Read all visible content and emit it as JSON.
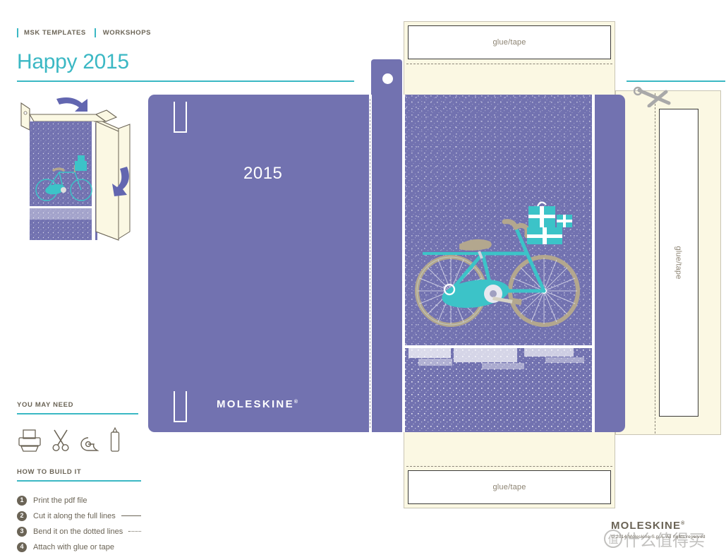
{
  "breadcrumb": {
    "items": [
      {
        "label": "MSK TEMPLATES"
      },
      {
        "label": "WORKSHOPS"
      }
    ]
  },
  "header": {
    "title": "Happy 2015"
  },
  "cover": {
    "year": "2015",
    "brand": "MOLESKINE",
    "brand_mark": "®"
  },
  "dieline": {
    "glue_top_label": "glue/tape",
    "glue_bottom_label": "glue/tape",
    "glue_right_label": "glue/tape"
  },
  "need": {
    "heading": "YOU MAY NEED",
    "tools": [
      {
        "name": "printer-icon",
        "label": "printer"
      },
      {
        "name": "scissors-icon",
        "label": "scissors"
      },
      {
        "name": "tape-icon",
        "label": "tape"
      },
      {
        "name": "glue-bottle-icon",
        "label": "glue"
      }
    ]
  },
  "build": {
    "heading": "HOW TO BUILD IT",
    "steps": [
      {
        "num": "1",
        "text": "Print the pdf file",
        "sample": "none"
      },
      {
        "num": "2",
        "text": "Cut it along the full lines",
        "sample": "solid"
      },
      {
        "num": "3",
        "text": "Bend it on the dotted lines",
        "sample": "dotted"
      },
      {
        "num": "4",
        "text": "Attach with glue or tape",
        "sample": "none"
      }
    ]
  },
  "footer": {
    "brand": "MOLESKINE",
    "brand_mark": "®",
    "copyright": "© 2014 Moleskine S.p.A. All rights reserved"
  },
  "watermark": {
    "mark": "值",
    "text": "什么值得买"
  },
  "colors": {
    "teal": "#3bb8c4",
    "purple": "#7272b0",
    "cream": "#fbf8e3",
    "brown": "#6b6456",
    "bike_teal": "#3cc3c8",
    "tan": "#b3a78e"
  }
}
